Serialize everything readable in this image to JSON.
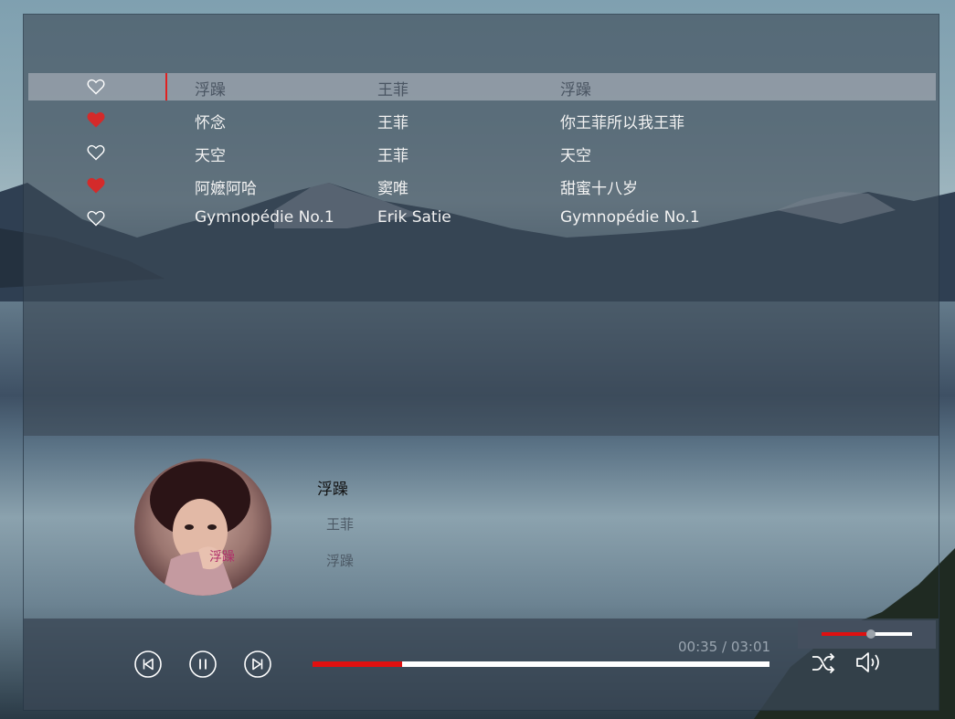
{
  "playlist": [
    {
      "liked": false,
      "title": "浮躁",
      "artist": "王菲",
      "album": "浮躁",
      "active": true
    },
    {
      "liked": true,
      "title": "怀念",
      "artist": "王菲",
      "album": "你王菲所以我王菲",
      "active": false
    },
    {
      "liked": false,
      "title": "天空",
      "artist": "王菲",
      "album": "天空",
      "active": false
    },
    {
      "liked": true,
      "title": "阿嬷阿哈",
      "artist": "窦唯",
      "album": "甜蜜十八岁",
      "active": false
    },
    {
      "liked": false,
      "title": "Gymnopédie No.1",
      "artist": "Erik Satie",
      "album": "Gymnopédie No.1",
      "active": false
    }
  ],
  "now_playing": {
    "title": "浮躁",
    "artist": "王菲",
    "album": "浮躁",
    "cover_text": "浮躁"
  },
  "controls": {
    "prev_icon": "skip-previous-icon",
    "pause_icon": "pause-icon",
    "next_icon": "skip-next-icon",
    "shuffle_icon": "shuffle-icon",
    "volume_icon": "volume-icon"
  },
  "playback": {
    "elapsed": "00:35",
    "duration": "03:01",
    "time_display": "00:35 / 03:01",
    "progress_fraction": 0.195
  },
  "volume": {
    "level_fraction": 0.55
  },
  "colors": {
    "accent": "#e01010",
    "heart_liked": "#d42a2a",
    "heart_unliked": "#ffffff"
  }
}
